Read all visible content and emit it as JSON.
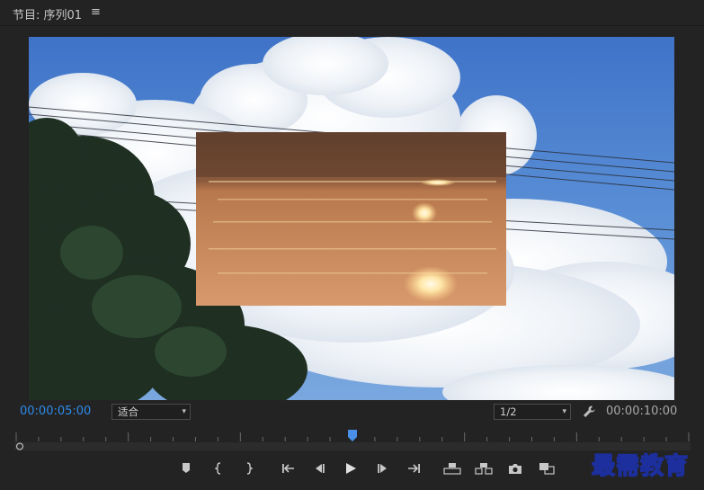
{
  "panel": {
    "title": "节目: 序列01",
    "menu_icon": "hamburger-menu-icon"
  },
  "controls": {
    "current_timecode": "00:00:05:00",
    "zoom_select": "适合",
    "resolution_select": "1/2",
    "settings_icon": "wrench-icon",
    "duration_timecode": "00:00:10:00"
  },
  "playhead": {
    "position_fraction": 0.5
  },
  "toolbar": [
    {
      "name": "add-marker-button",
      "icon": "marker-icon"
    },
    {
      "name": "mark-in-button",
      "icon": "mark-in-icon"
    },
    {
      "name": "mark-out-button",
      "icon": "mark-out-icon"
    },
    {
      "name": "go-to-in-button",
      "icon": "go-to-in-icon"
    },
    {
      "name": "step-back-button",
      "icon": "step-back-icon"
    },
    {
      "name": "play-button",
      "icon": "play-icon"
    },
    {
      "name": "step-forward-button",
      "icon": "step-forward-icon"
    },
    {
      "name": "go-to-out-button",
      "icon": "go-to-out-icon"
    },
    {
      "name": "lift-button",
      "icon": "lift-icon"
    },
    {
      "name": "extract-button",
      "icon": "extract-icon"
    },
    {
      "name": "export-frame-button",
      "icon": "camera-icon"
    },
    {
      "name": "compare-view-button",
      "icon": "compare-icon"
    }
  ],
  "watermark": "最需教育",
  "colors": {
    "accent": "#2d8ceb",
    "background": "#232323",
    "playhead": "#4a8fe8"
  }
}
